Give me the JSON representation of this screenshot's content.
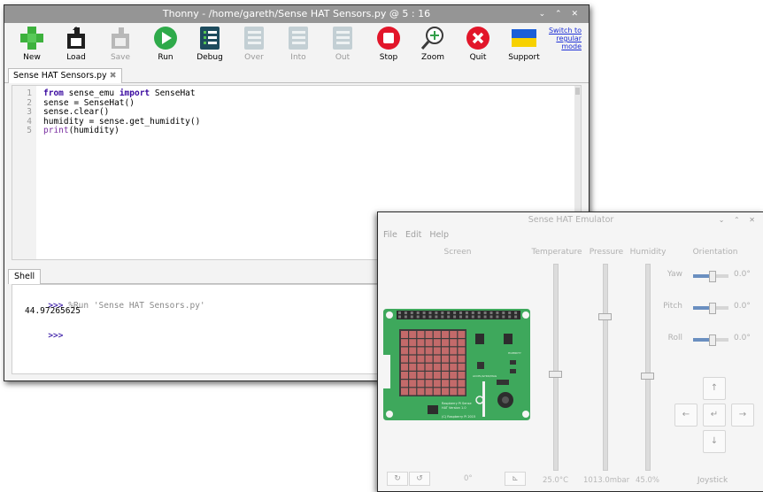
{
  "thonny": {
    "title": "Thonny  -  /home/gareth/Sense HAT Sensors.py  @  5 : 16",
    "window_controls": "⌄ ⌃ ✕",
    "toolbar": {
      "new": "New",
      "load": "Load",
      "save": "Save",
      "run": "Run",
      "debug": "Debug",
      "over": "Over",
      "into": "Into",
      "out": "Out",
      "stop": "Stop",
      "zoom": "Zoom",
      "quit": "Quit",
      "support": "Support"
    },
    "switch_mode": "Switch to regular mode",
    "editor_tab": "Sense HAT Sensors.py",
    "tab_close": "✖",
    "code": [
      {
        "n": "1",
        "parts": [
          [
            "kw",
            "from"
          ],
          [
            "t",
            " sense_emu "
          ],
          [
            "kw",
            "import"
          ],
          [
            "t",
            " SenseHat"
          ]
        ]
      },
      {
        "n": "2",
        "parts": [
          [
            "t",
            "sense = SenseHat()"
          ]
        ]
      },
      {
        "n": "3",
        "parts": [
          [
            "t",
            "sense.clear()"
          ]
        ]
      },
      {
        "n": "4",
        "parts": [
          [
            "t",
            "humidity = sense.get_humidity()"
          ]
        ]
      },
      {
        "n": "5",
        "parts": [
          [
            "kw2",
            "print"
          ],
          [
            "t",
            "(humidity)"
          ]
        ]
      }
    ],
    "shell_tab": "Shell",
    "shell": {
      "prompt": ">>>",
      "command": " %Run 'Sense HAT Sensors.py'",
      "output": "44.97265625"
    }
  },
  "emulator": {
    "title": "Sense HAT Emulator",
    "window_controls": "⌄ ⌃ ✕",
    "menu": [
      "File",
      "Edit",
      "Help"
    ],
    "headers": {
      "screen": "Screen",
      "temperature": "Temperature",
      "pressure": "Pressure",
      "humidity": "Humidity",
      "orientation": "Orientation"
    },
    "orientation": [
      {
        "label": "Yaw",
        "value": "0.0°"
      },
      {
        "label": "Pitch",
        "value": "0.0°"
      },
      {
        "label": "Roll",
        "value": "0.0°"
      }
    ],
    "readings": {
      "temperature": "25.0°C",
      "pressure": "1013.0mbar",
      "humidity": "45.0%"
    },
    "slider_levels": {
      "temperature": 0.47,
      "pressure": 0.75,
      "humidity": 0.46
    },
    "rotation": "0°",
    "joystick_label": "Joystick",
    "joystick": {
      "up": "↑",
      "left": "←",
      "center": "↵",
      "right": "→",
      "down": "↓"
    },
    "rotate_buttons": {
      "cw": "↻",
      "ccw": "↺",
      "flip": "⊾"
    },
    "board_labels": {
      "name": "Raspberry Pi Sense HAT Version 1.0",
      "copyright": "(C) Raspberry Pi 2015",
      "humidity_chip": "HUMIDITY",
      "accel_chip": "ACCEL/GYRO/MAG"
    }
  },
  "colors": {
    "board": "#3ea85c",
    "led": "#c36a6a",
    "header": "#2b2b2b",
    "accent": "#6a8fc0"
  }
}
